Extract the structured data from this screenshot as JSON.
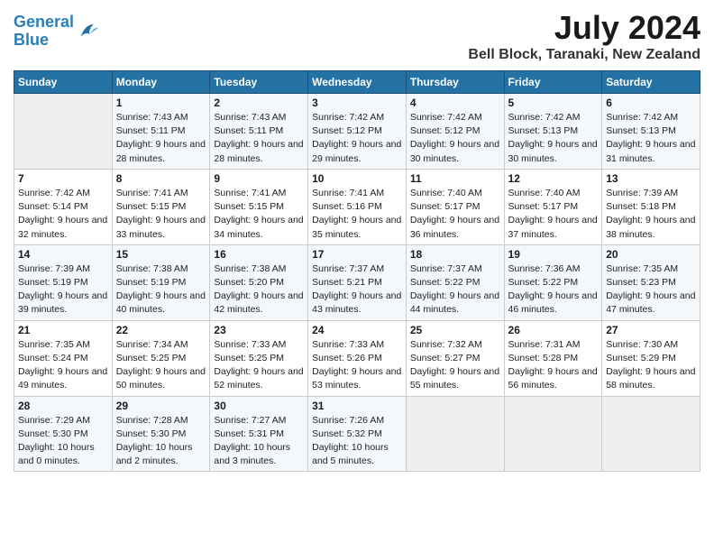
{
  "header": {
    "logo_line1": "General",
    "logo_line2": "Blue",
    "title": "July 2024",
    "subtitle": "Bell Block, Taranaki, New Zealand"
  },
  "weekdays": [
    "Sunday",
    "Monday",
    "Tuesday",
    "Wednesday",
    "Thursday",
    "Friday",
    "Saturday"
  ],
  "weeks": [
    [
      {
        "day": "",
        "sunrise": "",
        "sunset": "",
        "daylight": ""
      },
      {
        "day": "1",
        "sunrise": "Sunrise: 7:43 AM",
        "sunset": "Sunset: 5:11 PM",
        "daylight": "Daylight: 9 hours and 28 minutes."
      },
      {
        "day": "2",
        "sunrise": "Sunrise: 7:43 AM",
        "sunset": "Sunset: 5:11 PM",
        "daylight": "Daylight: 9 hours and 28 minutes."
      },
      {
        "day": "3",
        "sunrise": "Sunrise: 7:42 AM",
        "sunset": "Sunset: 5:12 PM",
        "daylight": "Daylight: 9 hours and 29 minutes."
      },
      {
        "day": "4",
        "sunrise": "Sunrise: 7:42 AM",
        "sunset": "Sunset: 5:12 PM",
        "daylight": "Daylight: 9 hours and 30 minutes."
      },
      {
        "day": "5",
        "sunrise": "Sunrise: 7:42 AM",
        "sunset": "Sunset: 5:13 PM",
        "daylight": "Daylight: 9 hours and 30 minutes."
      },
      {
        "day": "6",
        "sunrise": "Sunrise: 7:42 AM",
        "sunset": "Sunset: 5:13 PM",
        "daylight": "Daylight: 9 hours and 31 minutes."
      }
    ],
    [
      {
        "day": "7",
        "sunrise": "Sunrise: 7:42 AM",
        "sunset": "Sunset: 5:14 PM",
        "daylight": "Daylight: 9 hours and 32 minutes."
      },
      {
        "day": "8",
        "sunrise": "Sunrise: 7:41 AM",
        "sunset": "Sunset: 5:15 PM",
        "daylight": "Daylight: 9 hours and 33 minutes."
      },
      {
        "day": "9",
        "sunrise": "Sunrise: 7:41 AM",
        "sunset": "Sunset: 5:15 PM",
        "daylight": "Daylight: 9 hours and 34 minutes."
      },
      {
        "day": "10",
        "sunrise": "Sunrise: 7:41 AM",
        "sunset": "Sunset: 5:16 PM",
        "daylight": "Daylight: 9 hours and 35 minutes."
      },
      {
        "day": "11",
        "sunrise": "Sunrise: 7:40 AM",
        "sunset": "Sunset: 5:17 PM",
        "daylight": "Daylight: 9 hours and 36 minutes."
      },
      {
        "day": "12",
        "sunrise": "Sunrise: 7:40 AM",
        "sunset": "Sunset: 5:17 PM",
        "daylight": "Daylight: 9 hours and 37 minutes."
      },
      {
        "day": "13",
        "sunrise": "Sunrise: 7:39 AM",
        "sunset": "Sunset: 5:18 PM",
        "daylight": "Daylight: 9 hours and 38 minutes."
      }
    ],
    [
      {
        "day": "14",
        "sunrise": "Sunrise: 7:39 AM",
        "sunset": "Sunset: 5:19 PM",
        "daylight": "Daylight: 9 hours and 39 minutes."
      },
      {
        "day": "15",
        "sunrise": "Sunrise: 7:38 AM",
        "sunset": "Sunset: 5:19 PM",
        "daylight": "Daylight: 9 hours and 40 minutes."
      },
      {
        "day": "16",
        "sunrise": "Sunrise: 7:38 AM",
        "sunset": "Sunset: 5:20 PM",
        "daylight": "Daylight: 9 hours and 42 minutes."
      },
      {
        "day": "17",
        "sunrise": "Sunrise: 7:37 AM",
        "sunset": "Sunset: 5:21 PM",
        "daylight": "Daylight: 9 hours and 43 minutes."
      },
      {
        "day": "18",
        "sunrise": "Sunrise: 7:37 AM",
        "sunset": "Sunset: 5:22 PM",
        "daylight": "Daylight: 9 hours and 44 minutes."
      },
      {
        "day": "19",
        "sunrise": "Sunrise: 7:36 AM",
        "sunset": "Sunset: 5:22 PM",
        "daylight": "Daylight: 9 hours and 46 minutes."
      },
      {
        "day": "20",
        "sunrise": "Sunrise: 7:35 AM",
        "sunset": "Sunset: 5:23 PM",
        "daylight": "Daylight: 9 hours and 47 minutes."
      }
    ],
    [
      {
        "day": "21",
        "sunrise": "Sunrise: 7:35 AM",
        "sunset": "Sunset: 5:24 PM",
        "daylight": "Daylight: 9 hours and 49 minutes."
      },
      {
        "day": "22",
        "sunrise": "Sunrise: 7:34 AM",
        "sunset": "Sunset: 5:25 PM",
        "daylight": "Daylight: 9 hours and 50 minutes."
      },
      {
        "day": "23",
        "sunrise": "Sunrise: 7:33 AM",
        "sunset": "Sunset: 5:25 PM",
        "daylight": "Daylight: 9 hours and 52 minutes."
      },
      {
        "day": "24",
        "sunrise": "Sunrise: 7:33 AM",
        "sunset": "Sunset: 5:26 PM",
        "daylight": "Daylight: 9 hours and 53 minutes."
      },
      {
        "day": "25",
        "sunrise": "Sunrise: 7:32 AM",
        "sunset": "Sunset: 5:27 PM",
        "daylight": "Daylight: 9 hours and 55 minutes."
      },
      {
        "day": "26",
        "sunrise": "Sunrise: 7:31 AM",
        "sunset": "Sunset: 5:28 PM",
        "daylight": "Daylight: 9 hours and 56 minutes."
      },
      {
        "day": "27",
        "sunrise": "Sunrise: 7:30 AM",
        "sunset": "Sunset: 5:29 PM",
        "daylight": "Daylight: 9 hours and 58 minutes."
      }
    ],
    [
      {
        "day": "28",
        "sunrise": "Sunrise: 7:29 AM",
        "sunset": "Sunset: 5:30 PM",
        "daylight": "Daylight: 10 hours and 0 minutes."
      },
      {
        "day": "29",
        "sunrise": "Sunrise: 7:28 AM",
        "sunset": "Sunset: 5:30 PM",
        "daylight": "Daylight: 10 hours and 2 minutes."
      },
      {
        "day": "30",
        "sunrise": "Sunrise: 7:27 AM",
        "sunset": "Sunset: 5:31 PM",
        "daylight": "Daylight: 10 hours and 3 minutes."
      },
      {
        "day": "31",
        "sunrise": "Sunrise: 7:26 AM",
        "sunset": "Sunset: 5:32 PM",
        "daylight": "Daylight: 10 hours and 5 minutes."
      },
      {
        "day": "",
        "sunrise": "",
        "sunset": "",
        "daylight": ""
      },
      {
        "day": "",
        "sunrise": "",
        "sunset": "",
        "daylight": ""
      },
      {
        "day": "",
        "sunrise": "",
        "sunset": "",
        "daylight": ""
      }
    ]
  ]
}
